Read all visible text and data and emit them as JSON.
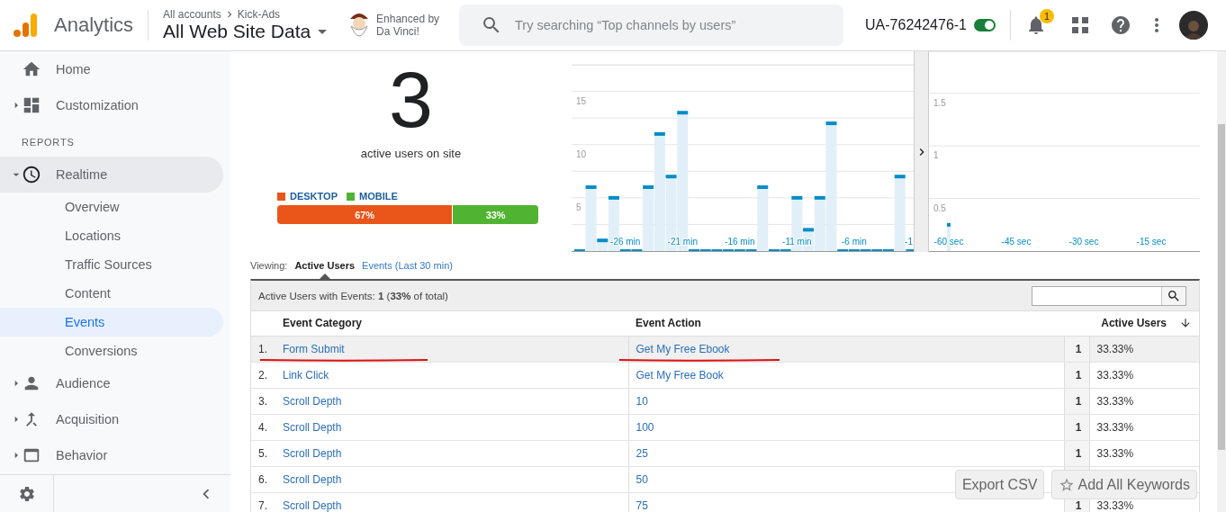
{
  "header": {
    "product": "Analytics",
    "breadcrumb": [
      "All accounts",
      "Kick-Ads"
    ],
    "view": "All Web Site Data",
    "enhanced_by": "Enhanced by Da Vinci!",
    "search": {
      "placeholder": "Try searching “Top channels by users”"
    },
    "property_id": "UA-76242476-1",
    "property_toggle": {
      "on": true
    },
    "notifications": {
      "count": "1"
    }
  },
  "sidebar": {
    "items": [
      {
        "kind": "item",
        "label": "Home",
        "expandable": false,
        "expanded": false
      },
      {
        "kind": "item",
        "label": "Customization",
        "expandable": true,
        "expanded": false
      },
      {
        "kind": "heading",
        "label": "REPORTS"
      },
      {
        "kind": "item",
        "label": "Realtime",
        "expandable": true,
        "expanded": true,
        "children": [
          {
            "label": "Overview",
            "selected": false
          },
          {
            "label": "Locations",
            "selected": false
          },
          {
            "label": "Traffic Sources",
            "selected": false
          },
          {
            "label": "Content",
            "selected": false
          },
          {
            "label": "Events",
            "selected": true
          },
          {
            "label": "Conversions",
            "selected": false
          }
        ]
      },
      {
        "kind": "item",
        "label": "Audience",
        "expandable": true,
        "expanded": false
      },
      {
        "kind": "item",
        "label": "Acquisition",
        "expandable": true,
        "expanded": false
      },
      {
        "kind": "item",
        "label": "Behavior",
        "expandable": true,
        "expanded": false
      }
    ]
  },
  "summary": {
    "count": "3",
    "caption": "active users on site",
    "devices": [
      {
        "label": "DESKTOP",
        "color": "#ea5519",
        "share": "67%",
        "level": 0.67
      },
      {
        "label": "MOBILE",
        "color": "#50b432",
        "share": "33%",
        "level": 0.33
      }
    ]
  },
  "per_minute": {
    "chart_data": {
      "type": "bar",
      "x": [
        -30,
        -29,
        -28,
        -27,
        -26,
        -25,
        -24,
        -23,
        -22,
        -21,
        -20,
        -19,
        -18,
        -17,
        -16,
        -15,
        -14,
        -13,
        -12,
        -11,
        -10,
        -9,
        -8,
        -7,
        -6,
        -5,
        -4,
        -3,
        -2,
        -1
      ],
      "values": [
        0,
        6,
        1,
        5,
        0,
        0,
        6,
        11,
        7,
        13,
        0,
        0,
        0,
        0,
        0,
        0,
        6,
        0,
        0,
        5,
        2,
        5,
        12,
        0,
        0,
        0,
        0,
        0,
        7,
        0
      ],
      "xticks": [
        {
          "value": -26,
          "label": "-26 min"
        },
        {
          "value": -21,
          "label": "-21 min"
        },
        {
          "value": -16,
          "label": "-16 min"
        },
        {
          "value": -11,
          "label": "-11 min"
        },
        {
          "value": -6,
          "label": "-6 min"
        },
        {
          "value": -1,
          "label": "-1"
        }
      ],
      "yticks": [
        5,
        10,
        15
      ],
      "xlim": [
        -30.7,
        -0.8
      ],
      "ylim": [
        0,
        17.5
      ],
      "grid": true
    }
  },
  "per_second": {
    "chart_data": {
      "type": "bar",
      "x": [
        -60
      ],
      "values": [
        0.25
      ],
      "xticks": [
        {
          "value": -60,
          "label": "-60 sec"
        },
        {
          "value": -45,
          "label": "-45 sec"
        },
        {
          "value": -30,
          "label": "-30 sec"
        },
        {
          "value": -15,
          "label": "-15 sec"
        }
      ],
      "yticks": [
        0.5,
        1,
        1.5
      ],
      "xlim": [
        -64.4,
        -4.2
      ],
      "ylim": [
        0,
        1.9
      ],
      "grid": true
    }
  },
  "viewing": {
    "label": "Viewing:",
    "tabs": [
      {
        "label": "Active Users",
        "selected": true
      },
      {
        "label": "Events (Last 30 min)",
        "selected": false
      }
    ]
  },
  "table": {
    "summary": "Active Users with Events: **1** (**33%** of total)",
    "columns": [
      {
        "label": "Event Category",
        "sorted": false
      },
      {
        "label": "Event Action",
        "sorted": false
      },
      {
        "label": "Active Users",
        "sorted": true
      }
    ],
    "rows": [
      {
        "index": "1.",
        "category": "Form Submit",
        "action": "Get My Free Ebook",
        "users": "1",
        "share": "33.33%",
        "highlighted": true,
        "marked": true
      },
      {
        "index": "2.",
        "category": "Link Click",
        "action": "Get My Free Book",
        "users": "1",
        "share": "33.33%",
        "highlighted": false,
        "marked": false
      },
      {
        "index": "3.",
        "category": "Scroll Depth",
        "action": "10",
        "users": "1",
        "share": "33.33%",
        "highlighted": false,
        "marked": false
      },
      {
        "index": "4.",
        "category": "Scroll Depth",
        "action": "100",
        "users": "1",
        "share": "33.33%",
        "highlighted": false,
        "marked": false
      },
      {
        "index": "5.",
        "category": "Scroll Depth",
        "action": "25",
        "users": "1",
        "share": "33.33%",
        "highlighted": false,
        "marked": false
      },
      {
        "index": "6.",
        "category": "Scroll Depth",
        "action": "50",
        "highlighted": false,
        "marked": false
      },
      {
        "index": "7.",
        "category": "Scroll Depth",
        "action": "75",
        "users": "1",
        "share": "33.33%",
        "highlighted": false,
        "marked": false
      }
    ]
  },
  "floating_buttons": [
    "Export CSV",
    "Add All Keywords"
  ]
}
